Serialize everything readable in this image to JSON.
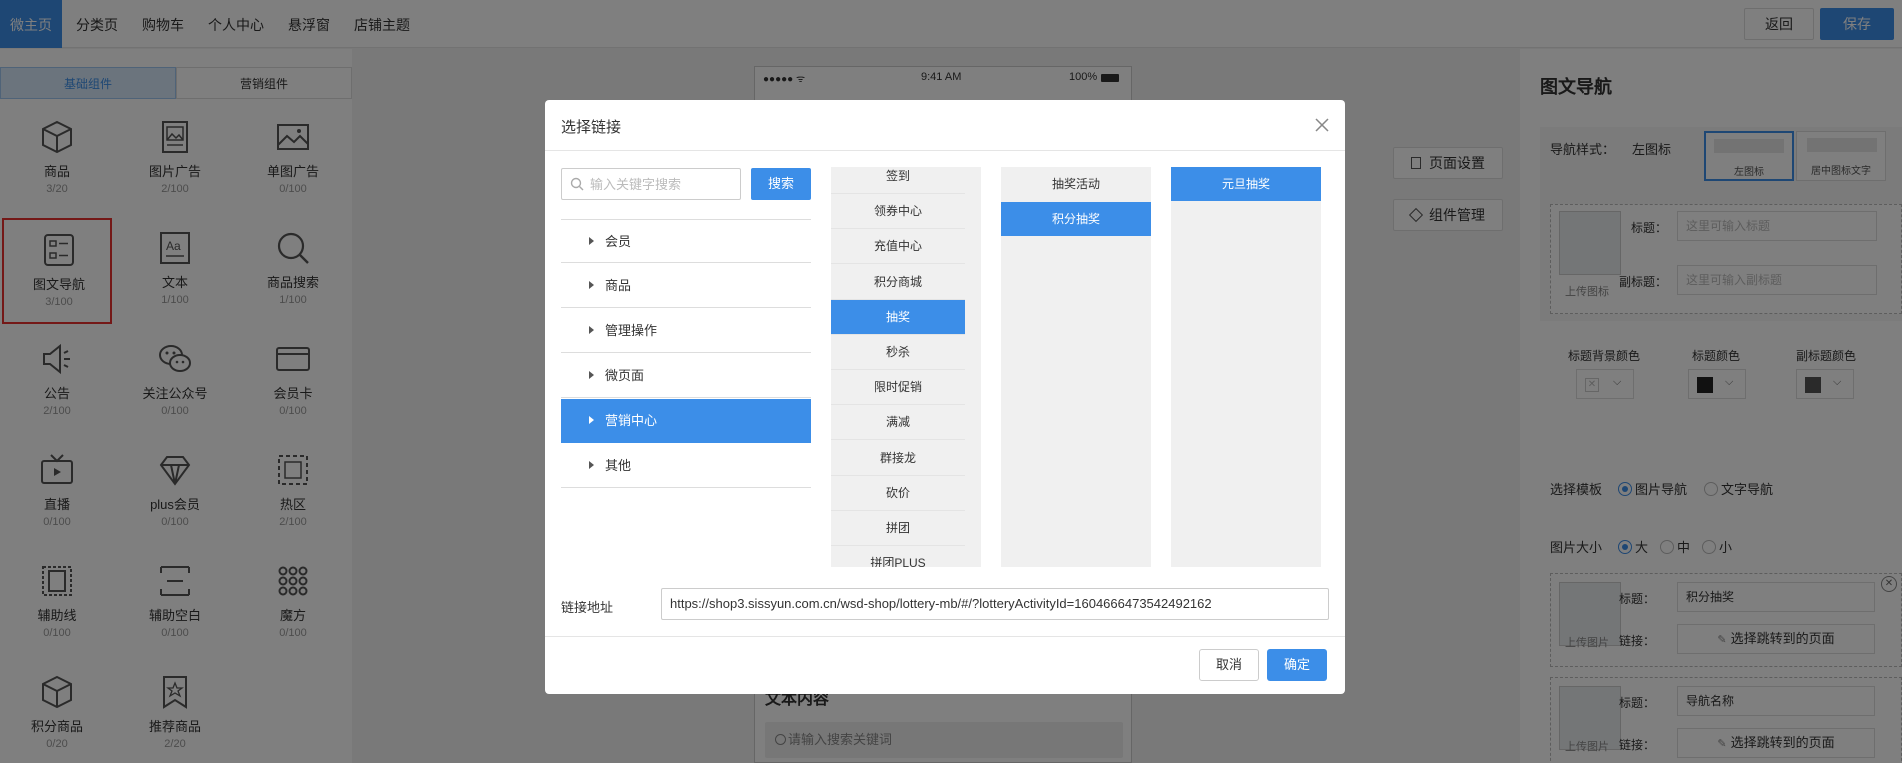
{
  "topbar": {
    "tabs": [
      "微主页",
      "分类页",
      "购物车",
      "个人中心",
      "悬浮窗",
      "店铺主题"
    ],
    "back_label": "返回",
    "save_label": "保存"
  },
  "left": {
    "tabs": [
      "基础组件",
      "营销组件"
    ],
    "components": [
      {
        "name": "商品",
        "count": "3/20",
        "icon": "cube-icon"
      },
      {
        "name": "图片广告",
        "count": "2/100",
        "icon": "image-ad-icon"
      },
      {
        "name": "单图广告",
        "count": "0/100",
        "icon": "single-image-icon"
      },
      {
        "name": "图文导航",
        "count": "3/100",
        "icon": "image-text-nav-icon"
      },
      {
        "name": "文本",
        "count": "1/100",
        "icon": "text-icon"
      },
      {
        "name": "商品搜索",
        "count": "1/100",
        "icon": "search-icon"
      },
      {
        "name": "公告",
        "count": "2/100",
        "icon": "megaphone-icon"
      },
      {
        "name": "关注公众号",
        "count": "0/100",
        "icon": "wechat-icon"
      },
      {
        "name": "会员卡",
        "count": "0/100",
        "icon": "card-icon"
      },
      {
        "name": "直播",
        "count": "0/100",
        "icon": "tv-icon"
      },
      {
        "name": "plus会员",
        "count": "0/100",
        "icon": "diamond-icon"
      },
      {
        "name": "热区",
        "count": "2/100",
        "icon": "hotspot-icon"
      },
      {
        "name": "辅助线",
        "count": "0/100",
        "icon": "guide-line-icon"
      },
      {
        "name": "辅助空白",
        "count": "0/100",
        "icon": "blank-space-icon"
      },
      {
        "name": "魔方",
        "count": "0/100",
        "icon": "grid-icon"
      },
      {
        "name": "积分商品",
        "count": "0/20",
        "icon": "points-cube-icon"
      },
      {
        "name": "推荐商品",
        "count": "2/20",
        "icon": "bookmark-star-icon"
      }
    ]
  },
  "phone": {
    "carrier": "●●●●● ᯤ",
    "time": "9:41 AM",
    "battery": "100%",
    "section_title": "文本内容",
    "search_placeholder": "请输入搜索关键词"
  },
  "side_buttons": [
    "页面设置",
    "组件管理"
  ],
  "right": {
    "title": "图文导航",
    "nav_style_label": "导航样式：",
    "nav_style_value": "左图标",
    "style_options": [
      "左图标",
      "居中图标文字"
    ],
    "upload_icon_label": "上传图标",
    "title_label": "标题：",
    "subtitle_label": "副标题：",
    "title_placeholder": "这里可输入标题",
    "subtitle_placeholder": "这里可输入副标题",
    "color_labels": [
      "标题背景颜色",
      "标题颜色",
      "副标题颜色"
    ],
    "template_label": "选择模板",
    "template_options": [
      "图片导航",
      "文字导航"
    ],
    "size_label": "图片大小",
    "size_options": [
      "大",
      "中",
      "小"
    ],
    "upload_image_label": "上传图片",
    "link_label": "链接：",
    "item1_title": "积分抽奖",
    "item2_placeholder": "导航名称",
    "link_button": "选择跳转到的页面"
  },
  "modal": {
    "title": "选择链接",
    "search_placeholder": "输入关键字搜索",
    "search_button": "搜索",
    "categories": [
      "会员",
      "商品",
      "管理操作",
      "微页面",
      "营销中心",
      "其他"
    ],
    "active_category": 4,
    "sub_items": [
      "签到",
      "领券中心",
      "充值中心",
      "积分商城",
      "抽奖",
      "秒杀",
      "限时促销",
      "满减",
      "群接龙",
      "砍价",
      "拼团",
      "拼团PLUS"
    ],
    "active_sub": 4,
    "col3_items": [
      "抽奖活动",
      "积分抽奖"
    ],
    "active_col3": 1,
    "col4_items": [
      "元旦抽奖"
    ],
    "active_col4": 0,
    "link_label": "链接地址",
    "link_value": "https://shop3.sissyun.com.cn/wsd-shop/lottery-mb/#/?lotteryActivityId=1604666473542492162",
    "cancel_label": "取消",
    "ok_label": "确定"
  }
}
